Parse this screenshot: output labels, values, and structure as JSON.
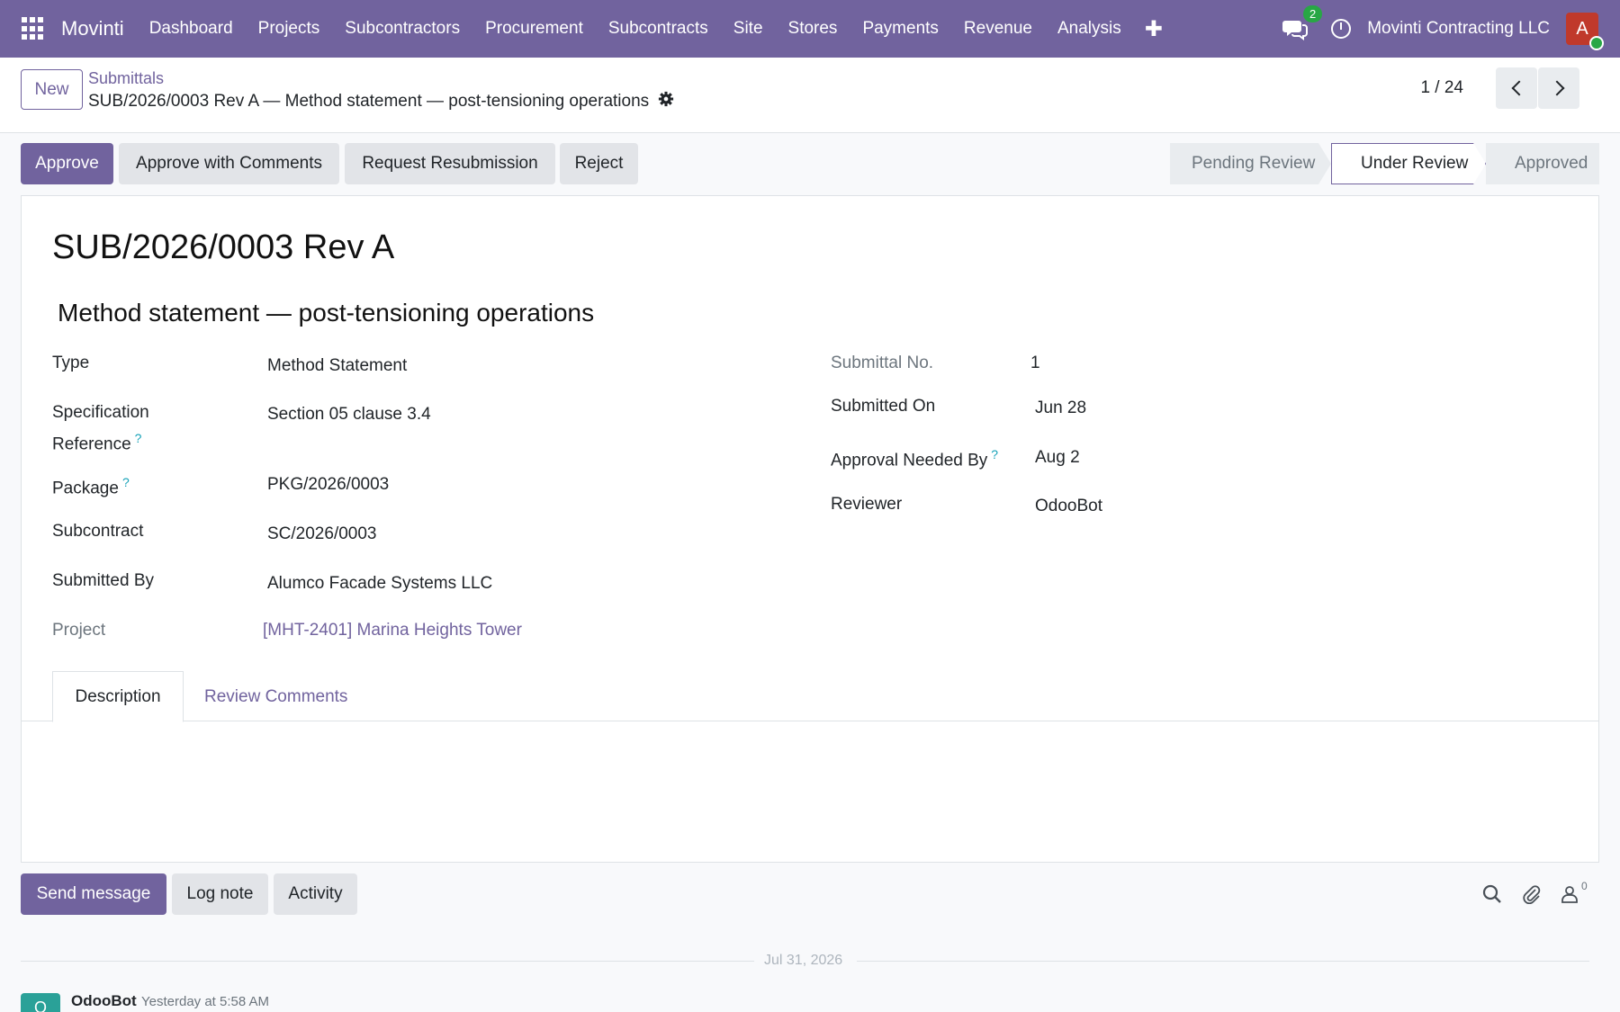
{
  "navbar": {
    "brand": "Movinti",
    "menu": [
      "Dashboard",
      "Projects",
      "Subcontractors",
      "Procurement",
      "Subcontracts",
      "Site",
      "Stores",
      "Payments",
      "Revenue",
      "Analysis"
    ],
    "plus": "✚",
    "chat_badge": "2",
    "company": "Movinti Contracting LLC",
    "avatar_letter": "A"
  },
  "control_panel": {
    "new_label": "New",
    "breadcrumb_parent": "Submittals",
    "breadcrumb_current": "SUB/2026/0003 Rev A — Method statement — post-tensioning operations",
    "pager": "1 / 24"
  },
  "actions": {
    "approve": "Approve",
    "approve_comments": "Approve with Comments",
    "request_resubmission": "Request Resubmission",
    "reject": "Reject"
  },
  "stages": [
    "Pending Review",
    "Under Review",
    "Approved"
  ],
  "record": {
    "name": "SUB/2026/0003 Rev A",
    "title": "Method statement — post-tensioning operations"
  },
  "fields_left": {
    "type_label": "Type",
    "type_value": "Method Statement",
    "spec_label_1": "Specification",
    "spec_label_2": "Reference",
    "spec_value": "Section 05 clause 3.4",
    "package_label": "Package",
    "package_value": "PKG/2026/0003",
    "subcontract_label": "Subcontract",
    "subcontract_value": "SC/2026/0003",
    "submitted_by_label": "Submitted By",
    "submitted_by_value": "Alumco Facade Systems LLC",
    "project_label": "Project",
    "project_value": "[MHT-2401] Marina Heights Tower"
  },
  "fields_right": {
    "submittal_no_label": "Submittal No.",
    "submittal_no_value": "1",
    "submitted_on_label": "Submitted On",
    "submitted_on_value": "Jun 28",
    "approval_needed_label": "Approval Needed By",
    "approval_needed_value": "Aug 2",
    "reviewer_label": "Reviewer",
    "reviewer_value": "OdooBot"
  },
  "help_mark": "?",
  "tabs": [
    "Description",
    "Review Comments"
  ],
  "chatter": {
    "send_message": "Send message",
    "log_note": "Log note",
    "activity": "Activity",
    "follower_count": "0",
    "date_separator": "Jul 31, 2026",
    "message_avatar": "O",
    "message_author": "OdooBot",
    "message_date": "Yesterday at 5:58 AM"
  },
  "colors": {
    "brand": "#71639e",
    "badge": "#28a745",
    "help": "#17a2b8",
    "avatar": "#c0392b"
  }
}
